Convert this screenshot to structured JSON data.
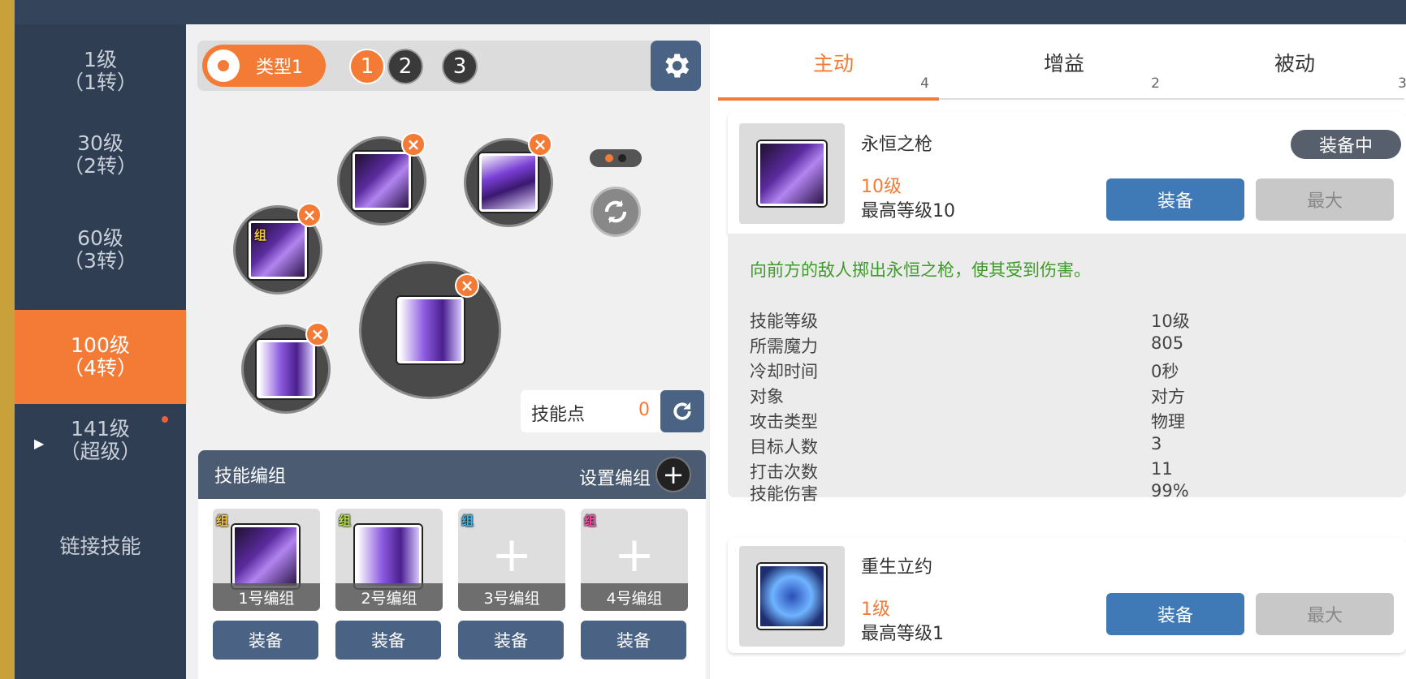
{
  "sidebar": {
    "items": [
      {
        "line1": "1级",
        "line2": "（1转）"
      },
      {
        "line1": "30级",
        "line2": "（2转）"
      },
      {
        "line1": "60级",
        "line2": "（3转）"
      },
      {
        "line1": "100级",
        "line2": "（4转）"
      },
      {
        "line1": "141级",
        "line2": "（超级）"
      },
      {
        "line1": "链接技能",
        "line2": ""
      }
    ],
    "active_index": 3
  },
  "type_selector": {
    "label": "类型1",
    "numbers": [
      "1",
      "2",
      "3"
    ],
    "active_number": "1"
  },
  "skill_slots": {
    "remove_symbol": "×",
    "group_tag": "组"
  },
  "skill_points": {
    "label": "技能点",
    "value": "0"
  },
  "skill_groups": {
    "title": "技能编组",
    "set_label": "设置编组",
    "add_symbol": "+",
    "tag": "组",
    "tag_colors": [
      "#f5c542",
      "#b7e04a",
      "#39b7e8",
      "#ff4fa8"
    ],
    "cards": [
      {
        "label": "1号编组",
        "equip": "装备"
      },
      {
        "label": "2号编组",
        "equip": "装备"
      },
      {
        "label": "3号编组",
        "equip": "装备"
      },
      {
        "label": "4号编组",
        "equip": "装备"
      }
    ]
  },
  "tabs": [
    {
      "label": "主动",
      "count": "4"
    },
    {
      "label": "增益",
      "count": "2"
    },
    {
      "label": "被动",
      "count": "3"
    }
  ],
  "skills": [
    {
      "name": "永恒之枪",
      "level": "10级",
      "max_level": "最高等级10",
      "badge": "装备中",
      "equip": "装备",
      "max": "最大"
    },
    {
      "name": "重生立约",
      "level": "1级",
      "max_level": "最高等级1",
      "equip": "装备",
      "max": "最大"
    }
  ],
  "detail": {
    "description": "向前方的敌人掷出永恒之枪，使其受到伤害。",
    "stats": [
      {
        "k": "技能等级",
        "v": "10级"
      },
      {
        "k": "所需魔力",
        "v": "805"
      },
      {
        "k": "冷却时间",
        "v": "0秒"
      },
      {
        "k": "对象",
        "v": "对方"
      },
      {
        "k": "攻击类型",
        "v": "物理"
      },
      {
        "k": "目标人数",
        "v": "3"
      },
      {
        "k": "打击次数",
        "v": "11"
      },
      {
        "k": "技能伤害",
        "v": "99%"
      }
    ]
  },
  "colors": {
    "accent": "#f47b36",
    "nav": "#2f3e52",
    "button_blue": "#3f7ab6",
    "description_green": "#3f9a2b"
  }
}
